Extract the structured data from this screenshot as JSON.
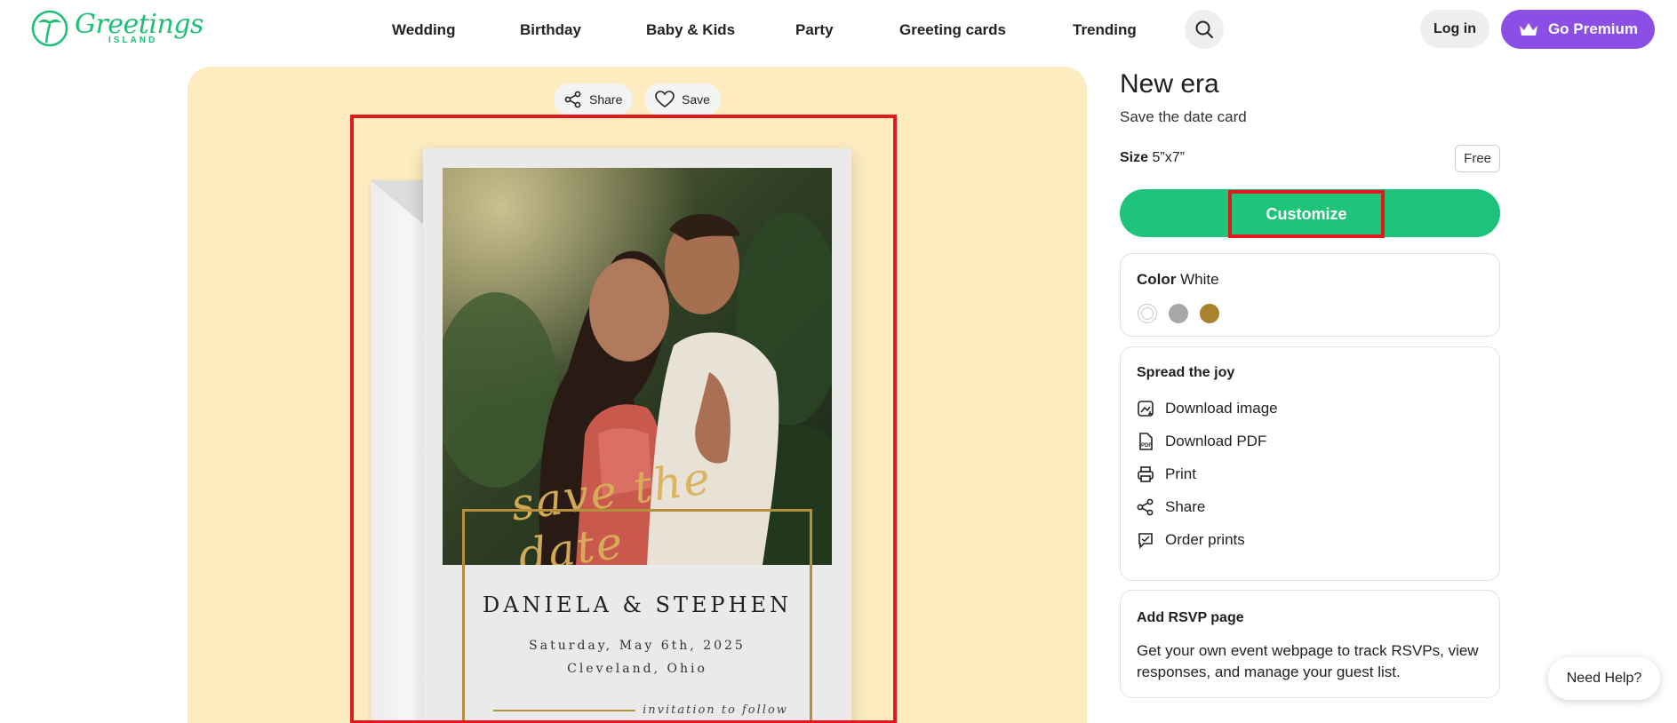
{
  "header": {
    "logo_main": "Greetings",
    "logo_sub": "ISLAND",
    "nav": [
      "Wedding",
      "Birthday",
      "Baby & Kids",
      "Party",
      "Greeting cards",
      "Trending"
    ],
    "search_icon": "search-icon",
    "login_label": "Log in",
    "premium_label": "Go Premium",
    "premium_icon": "crown-icon",
    "accent_color": "#1dbf77",
    "premium_color": "#8b4fe6"
  },
  "preview": {
    "share_label": "Share",
    "save_label": "Save",
    "background_color": "#fdecc0",
    "card": {
      "script_text": "save the date",
      "names": "DANIELA & STEPHEN",
      "date": "Saturday, May 6th, 2025",
      "place": "Cleveland, Ohio",
      "follow": "invitation to follow",
      "frame_color": "#b48f3e"
    }
  },
  "product": {
    "title": "New era",
    "subtitle": "Save the date card",
    "size_label": "Size",
    "size_value": "5”x7”",
    "price_badge": "Free",
    "customize_label": "Customize",
    "customize_color": "#1ec47a",
    "color_label": "Color",
    "color_value": "White",
    "swatches": [
      "#ffffff",
      "#a7a7a7",
      "#a8822c"
    ]
  },
  "spread": {
    "title": "Spread the joy",
    "items": [
      {
        "label": "Download image",
        "icon": "download-image-icon"
      },
      {
        "label": "Download PDF",
        "icon": "pdf-icon"
      },
      {
        "label": "Print",
        "icon": "printer-icon"
      },
      {
        "label": "Share",
        "icon": "share-icon"
      },
      {
        "label": "Order prints",
        "icon": "order-prints-icon"
      }
    ]
  },
  "rsvp": {
    "title": "Add RSVP page",
    "text": "Get your own event webpage to track RSVPs, view responses, and manage your guest list."
  },
  "help": {
    "label": "Need Help?"
  }
}
